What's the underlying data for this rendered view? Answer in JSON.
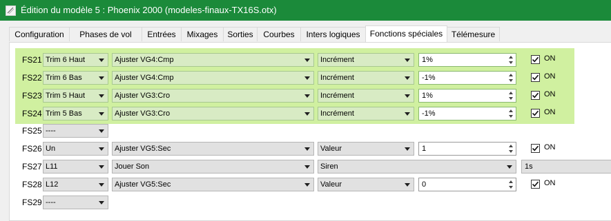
{
  "window": {
    "title": "Édition du modèle 5 : Phoenix 2000   (modeles-finaux-TX16S.otx)"
  },
  "tabs": [
    {
      "label": "Configuration"
    },
    {
      "label": "Phases de vol"
    },
    {
      "label": "Entrées"
    },
    {
      "label": "Mixages"
    },
    {
      "label": "Sorties"
    },
    {
      "label": "Courbes"
    },
    {
      "label": "Inters logiques"
    },
    {
      "label": "Fonctions spéciales",
      "active": true
    },
    {
      "label": "Télémesure"
    }
  ],
  "colors": {
    "titlebar": "#1b8a3a",
    "highlight": "#d0f0a0"
  },
  "rows": [
    {
      "id": "FS21",
      "switch": "Trim 6 Haut",
      "function": "Ajuster VG4:Cmp",
      "mode": "Incrément",
      "value": "1%",
      "enabled": true,
      "enabled_label": "ON"
    },
    {
      "id": "FS22",
      "switch": "Trim 6 Bas",
      "function": "Ajuster VG4:Cmp",
      "mode": "Incrément",
      "value": "-1%",
      "enabled": true,
      "enabled_label": "ON"
    },
    {
      "id": "FS23",
      "switch": "Trim 5 Haut",
      "function": "Ajuster VG3:Cro",
      "mode": "Incrément",
      "value": "1%",
      "enabled": true,
      "enabled_label": "ON"
    },
    {
      "id": "FS24",
      "switch": "Trim 5 Bas",
      "function": "Ajuster VG3:Cro",
      "mode": "Incrément",
      "value": "-1%",
      "enabled": true,
      "enabled_label": "ON"
    },
    {
      "id": "FS25",
      "switch": "----"
    },
    {
      "id": "FS26",
      "switch": "Un",
      "function": "Ajuster VG5:Sec",
      "mode": "Valeur",
      "value": "1",
      "enabled": true,
      "enabled_label": "ON"
    },
    {
      "id": "FS27",
      "switch": "L11",
      "function": "Jouer Son",
      "sound": "Siren",
      "repeat": "1s"
    },
    {
      "id": "FS28",
      "switch": "L12",
      "function": "Ajuster VG5:Sec",
      "mode": "Valeur",
      "value": "0",
      "enabled": true,
      "enabled_label": "ON"
    },
    {
      "id": "FS29",
      "switch": "----"
    }
  ]
}
